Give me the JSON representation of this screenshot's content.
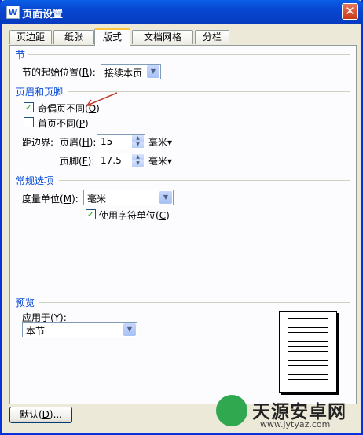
{
  "window": {
    "title": "页面设置",
    "app_icon": "W"
  },
  "tabs": [
    {
      "label": "页边距",
      "active": false
    },
    {
      "label": "纸张",
      "active": false
    },
    {
      "label": "版式",
      "active": true
    },
    {
      "label": "文档网格",
      "active": false
    },
    {
      "label": "分栏",
      "active": false
    }
  ],
  "section": {
    "title": "节",
    "start_label": "节的起始位置",
    "start_key": "R",
    "start_value": "接续本页"
  },
  "header_footer": {
    "title": "页眉和页脚",
    "odd_even_label": "奇偶页不同",
    "odd_even_key": "O",
    "odd_even_checked": true,
    "first_page_label": "首页不同",
    "first_page_key": "P",
    "first_page_checked": false,
    "margin_label": "距边界:",
    "header_label": "页眉",
    "header_key": "H",
    "header_value": "15",
    "header_unit": "毫米▾",
    "footer_label": "页脚",
    "footer_key": "F",
    "footer_value": "17.5",
    "footer_unit": "毫米▾"
  },
  "general": {
    "title": "常规选项",
    "unit_label": "度量单位",
    "unit_key": "M",
    "unit_value": "毫米",
    "char_unit_label": "使用字符单位",
    "char_unit_key": "C",
    "char_unit_checked": true
  },
  "preview": {
    "title": "预览",
    "apply_label": "应用于",
    "apply_key": "Y",
    "apply_value": "本节"
  },
  "buttons": {
    "default_label": "默认",
    "default_key": "D",
    "default_suffix": "..."
  },
  "watermark": {
    "brand": "天源安卓网",
    "url": "www.jytyaz.com"
  },
  "colors": {
    "accent": "#0046D5",
    "titlebar": "#0A5FE6",
    "check": "#21A121"
  }
}
